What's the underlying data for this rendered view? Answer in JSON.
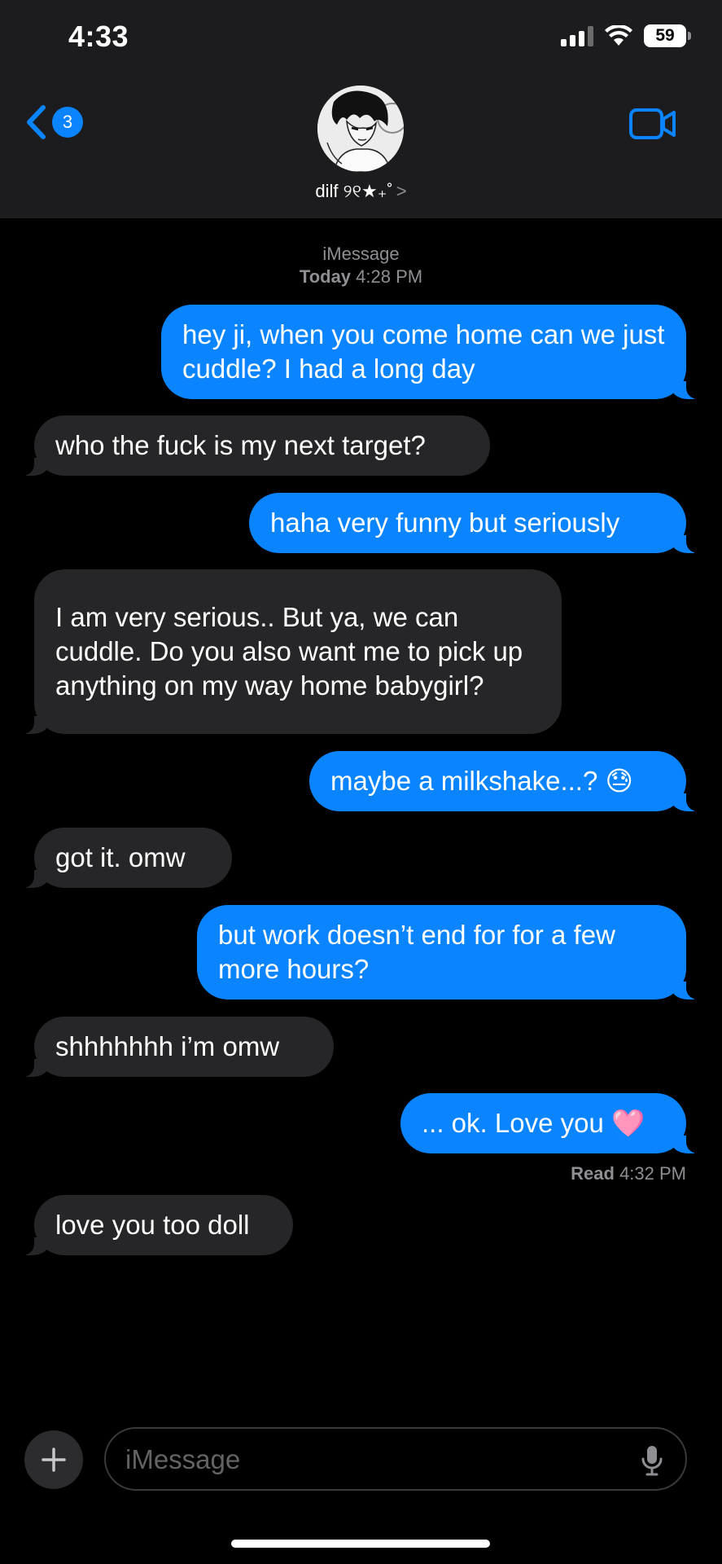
{
  "status_bar": {
    "time": "4:33",
    "battery": "59"
  },
  "header": {
    "back_count": "3",
    "contact_name": "dilf ୨୧★₊˚",
    "chevron": ">",
    "icons": [
      "chevron-left-icon",
      "video-camera-icon",
      "wifi-icon",
      "signal-icon"
    ]
  },
  "thread": {
    "service": "iMessage",
    "date_label": "Today",
    "date_time": "4:28 PM",
    "messages": [
      {
        "dir": "out",
        "text": "hey ji, when you come home can we just cuddle? I had a long day"
      },
      {
        "dir": "in",
        "text": "who the fuck is my next target?"
      },
      {
        "dir": "out",
        "text": "haha very funny but seriously"
      },
      {
        "dir": "in",
        "text": "I am very serious.. But ya, we can cuddle. Do you also want me to pick up anything on my way home babygirl?"
      },
      {
        "dir": "out",
        "text": "maybe a milkshake...? 😓"
      },
      {
        "dir": "in",
        "text": "got it. omw"
      },
      {
        "dir": "out",
        "text": "but work doesn’t end for for a few more hours?"
      },
      {
        "dir": "in",
        "text": "shhhhhhh i’m omw"
      },
      {
        "dir": "out",
        "text": "... ok. Love you 🩷"
      },
      {
        "dir": "in",
        "text": "love you too doll"
      }
    ],
    "read_label": "Read",
    "read_time": "4:32 PM"
  },
  "compose": {
    "placeholder": "iMessage",
    "icons": [
      "plus-icon",
      "microphone-icon"
    ]
  },
  "colors": {
    "outgoing": "#0a84ff",
    "incoming": "#262628",
    "background": "#000000",
    "header": "#1c1c1e"
  }
}
